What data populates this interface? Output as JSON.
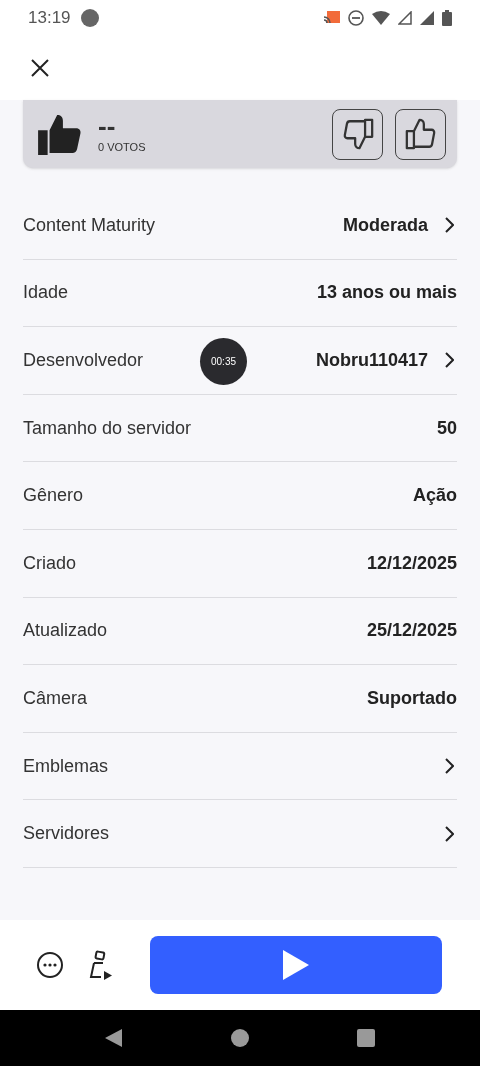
{
  "status_bar": {
    "time": "13:19"
  },
  "rating": {
    "score": "--",
    "votes": "0 VOTOS"
  },
  "details": [
    {
      "label": "Content Maturity",
      "value": "Moderada",
      "chevron": true
    },
    {
      "label": "Idade",
      "value": "13 anos ou mais",
      "chevron": false
    },
    {
      "label": "Desenvolvedor",
      "value": "Nobru110417",
      "chevron": true
    },
    {
      "label": "Tamanho do servidor",
      "value": "50",
      "chevron": false
    },
    {
      "label": "Gênero",
      "value": "Ação",
      "chevron": false
    },
    {
      "label": "Criado",
      "value": "12/12/2025",
      "chevron": false
    },
    {
      "label": "Atualizado",
      "value": "25/12/2025",
      "chevron": false
    },
    {
      "label": "Câmera",
      "value": "Suportado",
      "chevron": false
    },
    {
      "label": "Emblemas",
      "chevron": true
    },
    {
      "label": "Servidores",
      "chevron": true
    }
  ],
  "recording_bubble": {
    "time": "00:35"
  }
}
